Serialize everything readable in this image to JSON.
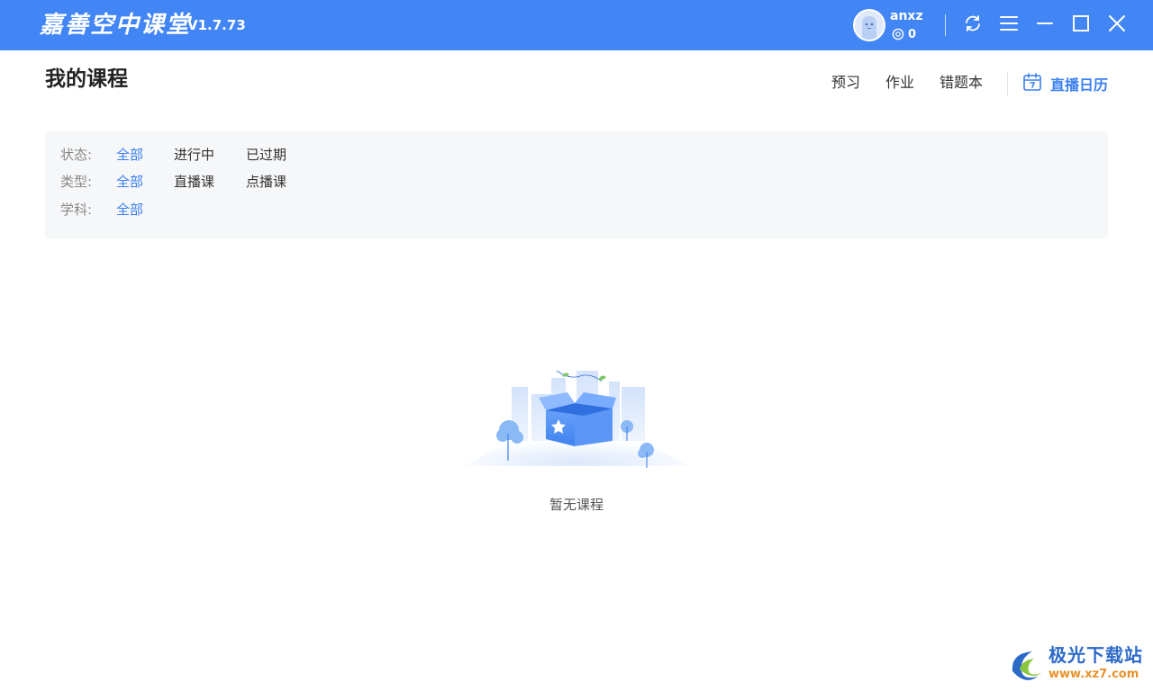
{
  "titlebar": {
    "app_name": "嘉善空中课堂",
    "version": "V1.7.73",
    "username": "anxz",
    "coins": "0",
    "icons": [
      "avatar-icon",
      "coin-icon",
      "refresh-icon",
      "menu-icon",
      "minimize-icon",
      "maximize-icon",
      "close-icon"
    ]
  },
  "header": {
    "title": "我的课程",
    "nav": {
      "preview": "预习",
      "homework": "作业",
      "mistakes": "错题本",
      "calendar": "直播日历"
    }
  },
  "filters": {
    "status": {
      "label": "状态:",
      "options": [
        "全部",
        "进行中",
        "已过期"
      ],
      "selected": "全部"
    },
    "type": {
      "label": "类型:",
      "options": [
        "全部",
        "直播课",
        "点播课"
      ],
      "selected": "全部"
    },
    "subject": {
      "label": "学科:",
      "options": [
        "全部"
      ],
      "selected": "全部"
    }
  },
  "empty_state": {
    "message": "暂无课程",
    "illustration": "empty-box-illustration"
  },
  "watermark": {
    "name": "极光下载站",
    "url": "www.xz7.com"
  },
  "colors": {
    "titlebar": "#4285f4",
    "accent": "#3a7ff2",
    "panel_bg": "#f6f7f9",
    "muted_text": "#888888"
  }
}
